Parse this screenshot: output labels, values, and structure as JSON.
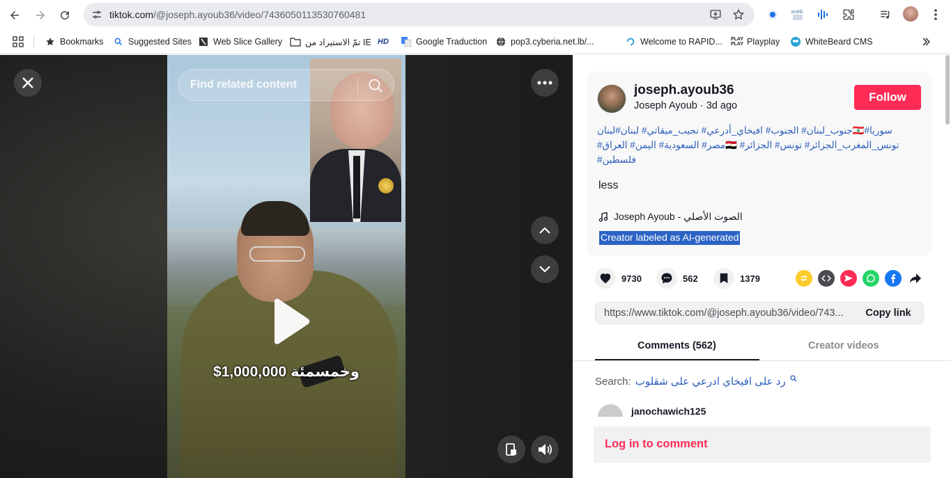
{
  "browser": {
    "url_domain": "tiktok.com",
    "url_path": "/@joseph.ayoub36/video/7436050113530760481"
  },
  "bookmarks": [
    {
      "label": "Bookmarks",
      "icon": "star-icon"
    },
    {
      "label": "Suggested Sites",
      "icon": "search-icon"
    },
    {
      "label": "Web Slice Gallery",
      "icon": "slice-icon"
    },
    {
      "label": "تمّ الاستيراد من IE",
      "icon": "folder-icon"
    },
    {
      "label": "",
      "icon": "hd-icon"
    },
    {
      "label": "Google Traduction",
      "icon": "translate-icon"
    },
    {
      "label": "pop3.cyberia.net.lb/...",
      "icon": "globe-icon"
    },
    {
      "label": "Welcome to RAPID...",
      "icon": "rapid-icon"
    },
    {
      "label": "Playplay",
      "icon": "playplay-icon"
    },
    {
      "label": "WhiteBeard CMS",
      "icon": "whitebeard-icon"
    }
  ],
  "video": {
    "search_placeholder": "Find related content",
    "caption": "$1,000,000 وخمسمئة"
  },
  "post": {
    "username": "joseph.ayoub36",
    "display_name_date": "Joseph Ayoub · 3d ago",
    "follow_label": "Follow",
    "hashtag_lines": [
      "سوريا#🇱🇧جنوب_لبنان# الجنوب# افيخاي_أدرعي# نجيب_ميقاتي# لبنان#لبنان",
      "تونس_المغرب_الجزائر# تونس# الجزائر# 🇪🇬مصر# السعودية# اليمن# العراق#",
      "فلسطين#"
    ],
    "less_label": "less",
    "music": "الصوت الأصلي - Joseph Ayoub",
    "ai_label": "Creator labeled as AI-generated"
  },
  "stats": {
    "likes": "9730",
    "comments": "562",
    "saves": "1379"
  },
  "share_link": {
    "url": "https://www.tiktok.com/@joseph.ayoub36/video/743...",
    "copy_label": "Copy link"
  },
  "tabs": {
    "comments": "Comments (562)",
    "creator_videos": "Creator videos"
  },
  "search": {
    "prefix": "Search:",
    "query": "رد على افيخاي ادرعي على شقلوب"
  },
  "comment_preview_name": "janochawich125",
  "login_label": "Log in to comment",
  "colors": {
    "accent": "#fe2c55",
    "hashtag": "#2b5db9",
    "highlight": "#2b63c5"
  }
}
